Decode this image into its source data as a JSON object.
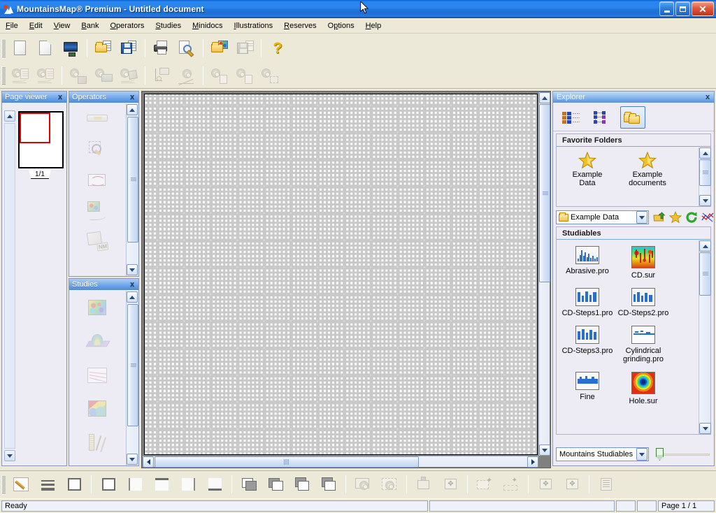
{
  "window": {
    "title": "MountainsMap® Premium - Untitled document",
    "icon": "mountains-logo-icon",
    "buttons": {
      "minimize": "minimize",
      "restore": "restore",
      "close": "close"
    }
  },
  "menubar": {
    "items": [
      {
        "label": "File",
        "accel": "F"
      },
      {
        "label": "Edit",
        "accel": "E"
      },
      {
        "label": "View",
        "accel": "V"
      },
      {
        "label": "Bank",
        "accel": "B"
      },
      {
        "label": "Operators",
        "accel": "O"
      },
      {
        "label": "Studies",
        "accel": "S"
      },
      {
        "label": "Minidocs",
        "accel": "M"
      },
      {
        "label": "Illustrations",
        "accel": "I"
      },
      {
        "label": "Reserves",
        "accel": "R"
      },
      {
        "label": "Options",
        "accel": "p"
      },
      {
        "label": "Help",
        "accel": "H"
      }
    ]
  },
  "toolbar_main": {
    "groups": [
      {
        "buttons": [
          {
            "name": "new-document",
            "icon": "blank-page-icon",
            "enabled": true
          },
          {
            "name": "new-from-template",
            "icon": "page-corner-icon",
            "enabled": true
          },
          {
            "name": "screen-view",
            "icon": "monitor-icon",
            "enabled": true
          }
        ]
      },
      {
        "buttons": [
          {
            "name": "open-document",
            "icon": "open-folder-document-icon",
            "enabled": true
          },
          {
            "name": "save-document",
            "icon": "floppy-save-icon",
            "enabled": true
          }
        ]
      },
      {
        "buttons": [
          {
            "name": "print",
            "icon": "printer-icon",
            "enabled": true
          },
          {
            "name": "print-preview",
            "icon": "preview-magnifier-icon",
            "enabled": true
          }
        ]
      },
      {
        "buttons": [
          {
            "name": "open-studiable",
            "icon": "open-folder-surface-icon",
            "enabled": true
          },
          {
            "name": "save-studiable",
            "icon": "save-surface-icon",
            "enabled": true
          }
        ]
      },
      {
        "buttons": [
          {
            "name": "help",
            "icon": "question-mark-icon",
            "enabled": true
          }
        ]
      }
    ]
  },
  "toolbar_secondary": {
    "groups": [
      {
        "buttons": [
          {
            "name": "extract-profile",
            "icon": "gear-sheet-curve-icon",
            "enabled": false
          },
          {
            "name": "extract-profile-series",
            "icon": "gear-sheet-wave-icon",
            "enabled": false
          }
        ]
      },
      {
        "buttons": [
          {
            "name": "operator-image",
            "icon": "gear-image-icon",
            "enabled": false
          },
          {
            "name": "operator-surface",
            "icon": "gear-surface-icon",
            "enabled": false
          },
          {
            "name": "operator-curve",
            "icon": "gear-curve-icon",
            "enabled": false
          }
        ]
      },
      {
        "buttons": [
          {
            "name": "study-chart",
            "icon": "chart-axes-icon",
            "enabled": false
          },
          {
            "name": "study-profile",
            "icon": "gear-profile-icon",
            "enabled": false
          }
        ]
      },
      {
        "buttons": [
          {
            "name": "minidoc-1",
            "icon": "gear-minidoc-icon",
            "enabled": false
          },
          {
            "name": "minidoc-2",
            "icon": "gear-minidoc2-icon",
            "enabled": false
          },
          {
            "name": "minidoc-3",
            "icon": "gear-minidoc3-icon",
            "enabled": false
          }
        ]
      }
    ]
  },
  "page_viewer": {
    "title": "Page viewer",
    "close": "x",
    "page_indicator": "1/1",
    "scroll_up": "scroll-up",
    "scroll_down": "scroll-down"
  },
  "operators": {
    "title": "Operators",
    "close": "x",
    "items": [
      {
        "name": "operator-level",
        "icon": "level-bar-icon"
      },
      {
        "name": "operator-zoom",
        "icon": "dashed-magnifier-icon"
      },
      {
        "name": "operator-threshold",
        "icon": "threshold-curve-icon"
      },
      {
        "name": "operator-extract-profile",
        "icon": "colormap-curve-icon"
      },
      {
        "name": "operator-nm-convert",
        "icon": "nm-surface-icon"
      }
    ]
  },
  "studies": {
    "title": "Studies",
    "close": "x",
    "items": [
      {
        "name": "study-colormap",
        "icon": "colormap-icon"
      },
      {
        "name": "study-3d-view",
        "icon": "surface-3d-icon"
      },
      {
        "name": "study-curves",
        "icon": "curves-chart-icon"
      },
      {
        "name": "study-segmentation",
        "icon": "segmented-map-icon"
      },
      {
        "name": "study-measure",
        "icon": "ruler-compass-icon"
      }
    ]
  },
  "document": {
    "scroll_left": "scroll-left",
    "scroll_right": "scroll-right",
    "scroll_up": "scroll-up",
    "scroll_down": "scroll-down"
  },
  "explorer": {
    "title": "Explorer",
    "close": "x",
    "view_buttons": [
      {
        "name": "view-details",
        "icon": "list-details-icon",
        "selected": false
      },
      {
        "name": "view-tree",
        "icon": "tree-view-icon",
        "selected": false
      },
      {
        "name": "view-folders",
        "icon": "folders-icon",
        "selected": true
      }
    ],
    "favorites": {
      "header": "Favorite Folders",
      "items": [
        {
          "name": "favorite-example-data",
          "icon": "star-icon",
          "label": "Example\nData",
          "line1": "Example",
          "line2": "Data"
        },
        {
          "name": "favorite-example-documents",
          "icon": "star-icon",
          "label": "Example documents",
          "line1": "Example",
          "line2": "documents"
        }
      ]
    },
    "path_combo": {
      "name": "folder-path-combo",
      "value": "Example Data",
      "icon": "folder-icon",
      "dropdown": "chevron-down-icon"
    },
    "path_buttons": [
      {
        "name": "up-one-level-button",
        "icon": "up-folder-arrow-icon"
      },
      {
        "name": "add-favorite-button",
        "icon": "star-icon"
      },
      {
        "name": "refresh-button",
        "icon": "refresh-circular-arrow-icon"
      },
      {
        "name": "filter-button",
        "icon": "red-blue-lines-icon"
      }
    ],
    "studiables": {
      "header": "Studiables",
      "items": [
        {
          "name": "studiable-abrasive-pro",
          "label": "Abrasive.pro",
          "thumb": "profile-spiky-blue-icon"
        },
        {
          "name": "studiable-cd-sur",
          "label": "CD.sur",
          "thumb": "colormap-rainbow-icon"
        },
        {
          "name": "studiable-cd-steps1-pro",
          "label": "CD-Steps1.pro",
          "thumb": "steps-profile-icon"
        },
        {
          "name": "studiable-cd-steps2-pro",
          "label": "CD-Steps2.pro",
          "thumb": "steps-profile-icon"
        },
        {
          "name": "studiable-cd-steps3-pro",
          "label": "CD-Steps3.pro",
          "thumb": "steps-profile-icon"
        },
        {
          "name": "studiable-cylindrical-grinding-pro",
          "label": "Cylindrical grinding.pro",
          "line1": "Cylindrical",
          "line2": "grinding.pro",
          "thumb": "flat-profile-icon"
        },
        {
          "name": "studiable-fine",
          "label": "Fine",
          "thumb": "dense-profile-icon"
        },
        {
          "name": "studiable-hole-sur",
          "label": "Hole.sur",
          "thumb": "hole-colormap-icon"
        }
      ]
    },
    "type_combo": {
      "name": "studiable-type-combo",
      "value": "Mountains Studiables",
      "dropdown": "chevron-down-icon"
    },
    "zoom_slider": {
      "name": "thumbnail-size-slider",
      "value": 8
    }
  },
  "toolbar_bottom": {
    "groups": [
      {
        "buttons": [
          {
            "name": "edit-page-layout",
            "icon": "pencil-frame-icon",
            "enabled": true
          },
          {
            "name": "line-styles",
            "icon": "three-lines-icon",
            "enabled": true
          },
          {
            "name": "frame-all-borders",
            "icon": "square-border-icon",
            "enabled": true
          }
        ]
      },
      {
        "buttons": [
          {
            "name": "border-box",
            "icon": "box-border-icon",
            "enabled": true
          },
          {
            "name": "border-left",
            "icon": "border-left-icon",
            "enabled": true
          },
          {
            "name": "border-top",
            "icon": "border-top-icon",
            "enabled": true
          },
          {
            "name": "border-right",
            "icon": "border-right-icon",
            "enabled": true
          },
          {
            "name": "border-bottom",
            "icon": "border-bottom-icon",
            "enabled": true
          }
        ]
      },
      {
        "buttons": [
          {
            "name": "bring-to-front",
            "icon": "layer-front-icon",
            "enabled": true
          },
          {
            "name": "send-to-back",
            "icon": "layer-back-icon",
            "enabled": true
          },
          {
            "name": "bring-forward",
            "icon": "layer-forward-icon",
            "enabled": true
          },
          {
            "name": "send-backward",
            "icon": "layer-backward-icon",
            "enabled": true
          }
        ]
      },
      {
        "buttons": [
          {
            "name": "insert-image",
            "icon": "insert-picture-icon",
            "enabled": false
          },
          {
            "name": "select-objects",
            "icon": "dashed-select-icon",
            "enabled": false
          }
        ]
      },
      {
        "buttons": [
          {
            "name": "paste-object",
            "icon": "paste-box-icon",
            "enabled": false
          },
          {
            "name": "move-object",
            "icon": "move-cross-icon",
            "enabled": false
          }
        ]
      },
      {
        "buttons": [
          {
            "name": "add-object",
            "icon": "add-box-icon",
            "enabled": false
          },
          {
            "name": "add-region",
            "icon": "add-dashed-region-icon",
            "enabled": false
          }
        ]
      },
      {
        "buttons": [
          {
            "name": "align-center",
            "icon": "align-move-icon",
            "enabled": false
          },
          {
            "name": "distribute",
            "icon": "distribute-move-icon",
            "enabled": false
          }
        ]
      },
      {
        "buttons": [
          {
            "name": "report-properties",
            "icon": "report-table-icon",
            "enabled": false
          }
        ]
      }
    ]
  },
  "statusbar": {
    "message": "Ready",
    "pane2": "",
    "pane3": "",
    "pane4": "",
    "page_info": "Page 1 / 1"
  }
}
